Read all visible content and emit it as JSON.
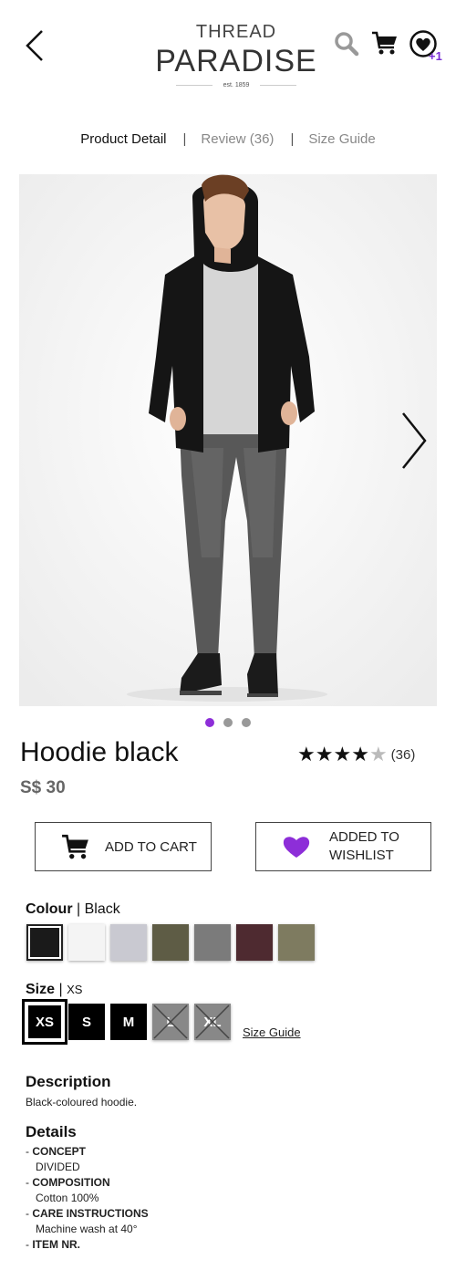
{
  "header": {
    "logo_top": "THREAD",
    "logo_main": "PARADISE",
    "logo_est": "est. 1859",
    "wishlist_count": "+1",
    "icons": [
      "back-arrow-icon",
      "search-icon",
      "cart-icon",
      "wishlist-heart-icon"
    ]
  },
  "tabs": [
    {
      "label": "Product Detail",
      "active": true
    },
    {
      "label": "Review (36)",
      "active": false
    },
    {
      "label": "Size Guide",
      "active": false
    }
  ],
  "gallery": {
    "image_count": 3,
    "current": 1
  },
  "product": {
    "name": "Hoodie black",
    "price": "S$ 30",
    "rating": 4,
    "rating_max": 5,
    "review_count": "(36)"
  },
  "actions": {
    "add_to_cart": "ADD TO CART",
    "added_to_wishlist_line1": "ADDED TO",
    "added_to_wishlist_line2": "WISHLIST"
  },
  "colour": {
    "label": "Colour",
    "selected": "Black",
    "swatches": [
      "#1a1a1a",
      "#f4f4f4",
      "#c9c9d1",
      "#5e5c45",
      "#7b7b7b",
      "#4e2a30",
      "#7e7b60"
    ]
  },
  "size": {
    "label": "Size",
    "selected": "XS",
    "options": [
      {
        "label": "XS",
        "available": true
      },
      {
        "label": "S",
        "available": true
      },
      {
        "label": "M",
        "available": true
      },
      {
        "label": "L",
        "available": false
      },
      {
        "label": "XL",
        "available": false
      }
    ],
    "guide_link": "Size Guide"
  },
  "description": {
    "title": "Description",
    "text": "Black-coloured hoodie."
  },
  "details": {
    "title": "Details",
    "items": [
      {
        "key": "CONCEPT",
        "value": "DIVIDED"
      },
      {
        "key": "COMPOSITION",
        "value": "Cotton 100%"
      },
      {
        "key": "CARE INSTRUCTIONS",
        "value": "Machine wash at 40°"
      },
      {
        "key": "ITEM NR.",
        "value": ""
      }
    ]
  },
  "colors": {
    "accent": "#8d2ed8",
    "text": "#111111",
    "muted": "#888888"
  }
}
